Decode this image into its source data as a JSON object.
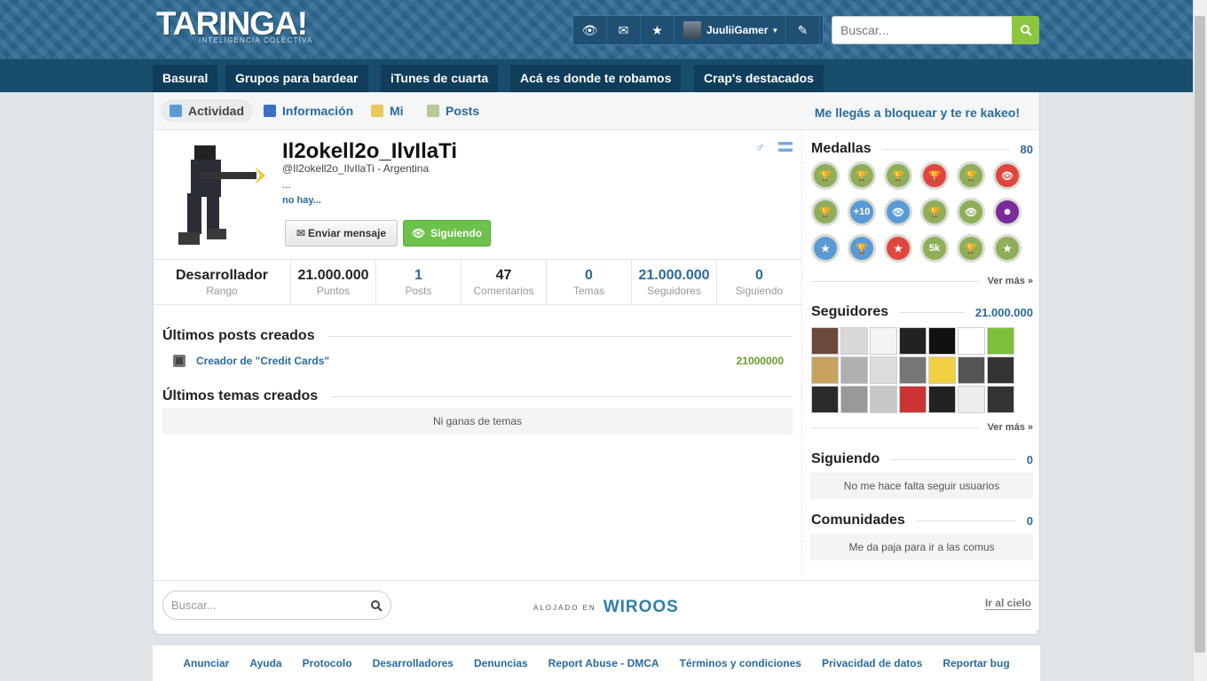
{
  "header": {
    "logo": "TARINGA!",
    "logo_sub": "INTELIGENCIA COLECTIVA",
    "username": "JuuliiGamer",
    "search_placeholder": "Buscar..."
  },
  "nav": [
    "Basural",
    "Grupos para bardear",
    "iTunes de cuarta",
    "Acá es donde te robamos",
    "Crap's destacados"
  ],
  "tabs": {
    "actividad": "Actividad",
    "informacion": "Información",
    "mi": "Mi",
    "posts": "Posts",
    "slogan": "Me llegás a bloquear y te re kakeo!"
  },
  "profile": {
    "name": "Il2okell2o_IlvIlaTi",
    "handle": "@Il2okell2o_IlvIlaTi - Argentina",
    "dots": "...",
    "more": "no hay...",
    "send_message": "Enviar mensaje",
    "following_btn": "Siguiendo"
  },
  "stats": [
    {
      "value": "Desarrollador",
      "label": "Rango"
    },
    {
      "value": "21.000.000",
      "label": "Puntos"
    },
    {
      "value": "1",
      "label": "Posts"
    },
    {
      "value": "47",
      "label": "Comentarios"
    },
    {
      "value": "0",
      "label": "Temas"
    },
    {
      "value": "21.000.000",
      "label": "Seguidores"
    },
    {
      "value": "0",
      "label": "Siguiendo"
    }
  ],
  "posts": {
    "title": "Últimos posts creados",
    "item": "Creador de \"Credit Cards\"",
    "item_points": "21000000"
  },
  "temas": {
    "title": "Últimos temas creados",
    "empty": "Ni ganas de temas"
  },
  "medals": {
    "title": "Medallas",
    "count": "80",
    "ver_mas": "Ver más »",
    "items": [
      {
        "color": "#8fae5a",
        "glyph": "🏆"
      },
      {
        "color": "#8fae5a",
        "glyph": "🏆"
      },
      {
        "color": "#8fae5a",
        "glyph": "🏆"
      },
      {
        "color": "#e0463f",
        "glyph": "🏆"
      },
      {
        "color": "#8fae5a",
        "glyph": "🏆"
      },
      {
        "color": "#e0463f",
        "glyph": "👁"
      },
      {
        "color": "#8fae5a",
        "glyph": "🏆"
      },
      {
        "color": "#5b9bd5",
        "glyph": "+10"
      },
      {
        "color": "#5b9bd5",
        "glyph": "👁"
      },
      {
        "color": "#8fae5a",
        "glyph": "🏆"
      },
      {
        "color": "#8fae5a",
        "glyph": "👁"
      },
      {
        "color": "#7a2a9a",
        "glyph": "☻"
      },
      {
        "color": "#5b9bd5",
        "glyph": "★"
      },
      {
        "color": "#5b9bd5",
        "glyph": "🏆"
      },
      {
        "color": "#e0463f",
        "glyph": "★"
      },
      {
        "color": "#8fae5a",
        "glyph": "5k"
      },
      {
        "color": "#8fae5a",
        "glyph": "🏆"
      },
      {
        "color": "#8fae5a",
        "glyph": "★"
      }
    ]
  },
  "followers": {
    "title": "Seguidores",
    "count": "21.000.000",
    "ver_mas": "Ver más »"
  },
  "following": {
    "title": "Siguiendo",
    "count": "0",
    "empty": "No me hace falta seguir usuarios"
  },
  "communities": {
    "title": "Comunidades",
    "count": "0",
    "empty": "Me da paja para ir a las comus"
  },
  "footer": {
    "search_placeholder": "Buscar...",
    "hosted_small": "ALOJADO EN",
    "hosted_brand": "WIROOS",
    "go_top": "Ir al cielo",
    "links": [
      "Anunciar",
      "Ayuda",
      "Protocolo",
      "Desarrolladores",
      "Denuncias",
      "Report Abuse - DMCA",
      "Términos y condiciones",
      "Privacidad de datos",
      "Reportar bug"
    ]
  }
}
